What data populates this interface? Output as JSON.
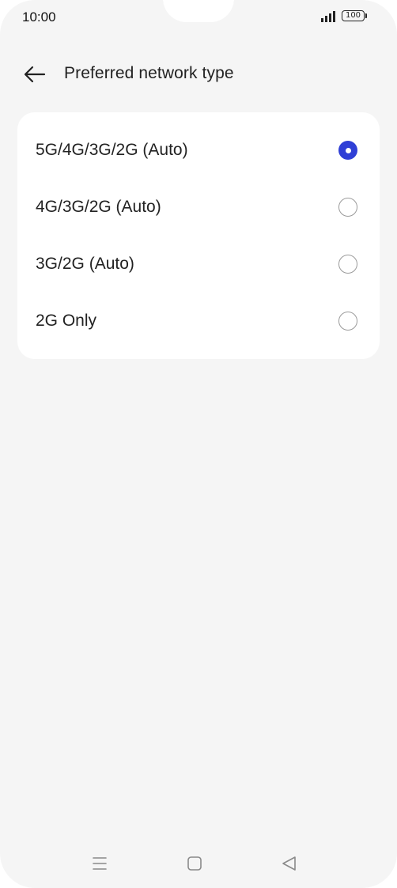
{
  "status_bar": {
    "time": "10:00",
    "battery": "100",
    "icons": [
      "signal-icon",
      "battery-icon"
    ]
  },
  "header": {
    "back_icon": "back-arrow-icon",
    "title": "Preferred network type"
  },
  "options": [
    {
      "label": "5G/4G/3G/2G (Auto)",
      "selected": true
    },
    {
      "label": "4G/3G/2G (Auto)",
      "selected": false
    },
    {
      "label": "3G/2G (Auto)",
      "selected": false
    },
    {
      "label": "2G Only",
      "selected": false
    }
  ],
  "navigation_bar": {
    "icons": [
      "menu-icon",
      "home-icon",
      "back-triangle-icon"
    ]
  },
  "colors": {
    "background": "#f5f5f5",
    "card": "#ffffff",
    "accent": "#2f3fd6",
    "text": "#222222"
  }
}
